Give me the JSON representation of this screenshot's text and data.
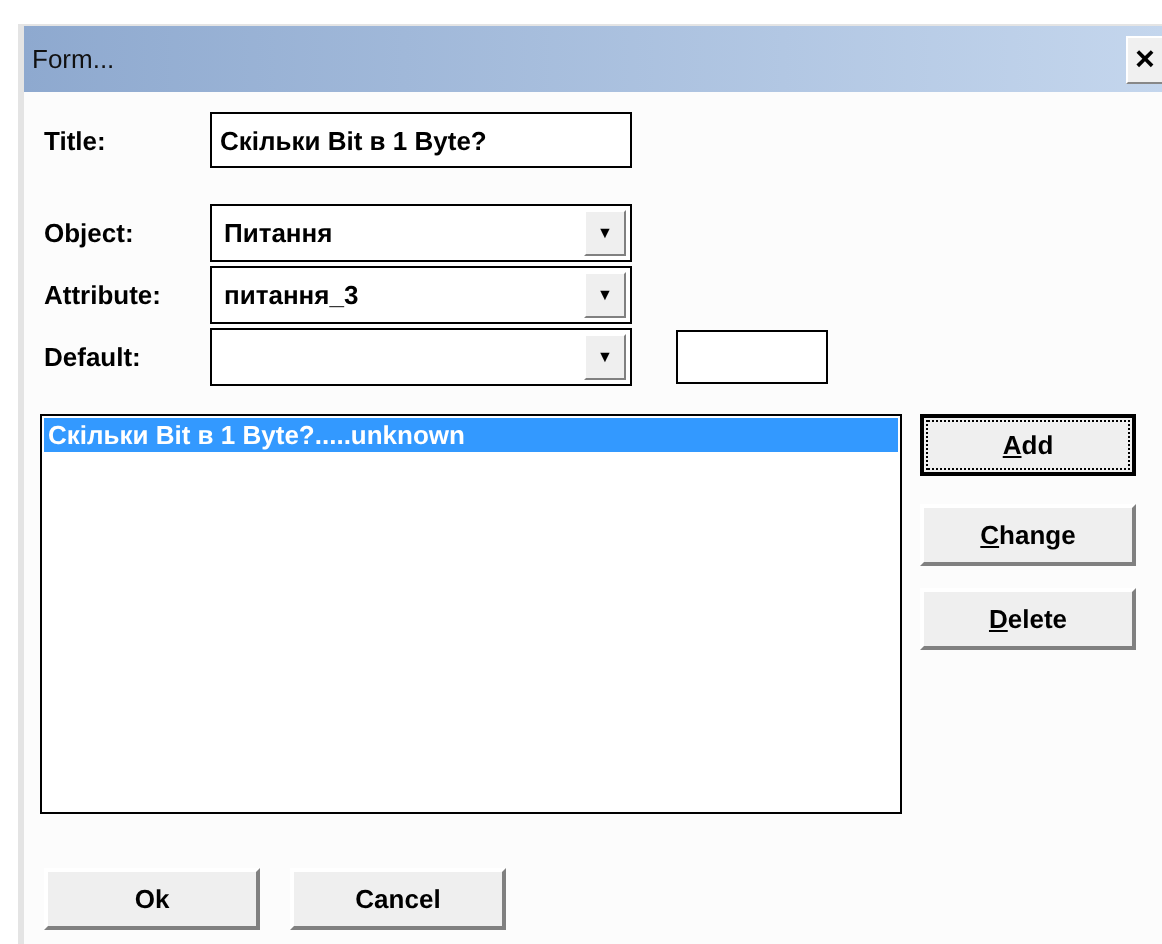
{
  "window": {
    "title": "Form...",
    "close": "×"
  },
  "fields": [
    {
      "label": "Title:",
      "kind": "text",
      "value": "Скільки Bit в 1 Byte?"
    },
    {
      "label": "Object:",
      "kind": "combo",
      "value": "Питання",
      "arrow": "▼"
    },
    {
      "label": "Attribute:",
      "kind": "combo",
      "value": "питання_3",
      "arrow": "▼"
    },
    {
      "label": "Default:",
      "kind": "combo",
      "arrow": "▼",
      "extra_field": true
    }
  ],
  "list": {
    "items": [
      {
        "text": "Скільки Bit в 1 Byte?.....unknown",
        "selected": true
      }
    ]
  },
  "side_buttons": [
    {
      "label": "Add",
      "underline_first": true,
      "focused": true
    },
    {
      "label": "Change",
      "underline_first": true,
      "focused": false
    },
    {
      "label": "Delete",
      "underline_first": true,
      "focused": false
    }
  ],
  "bottom_buttons": [
    {
      "label": "Ok",
      "underline_first": false,
      "focused": false
    },
    {
      "label": "Cancel",
      "underline_first": false,
      "focused": false
    }
  ]
}
